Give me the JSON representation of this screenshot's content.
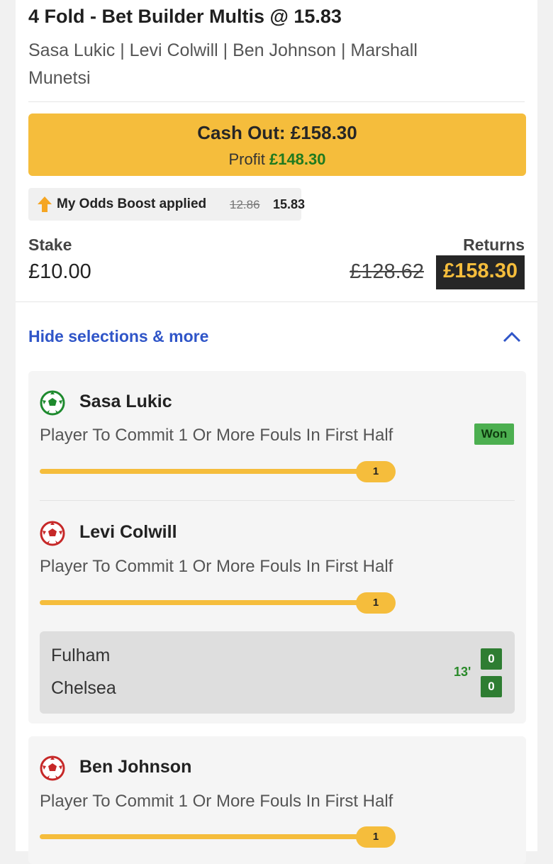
{
  "bet": {
    "title": "4 Fold - Bet Builder Multis @ 15.83",
    "players": "Sasa Lukic | Levi Colwill | Ben Johnson | Marshall Munetsi"
  },
  "cashout": {
    "label": "Cash Out: £158.30",
    "profit_label": "Profit",
    "profit_value": "£148.30"
  },
  "boost": {
    "label": "My Odds Boost applied",
    "old_odds": "12.86",
    "new_odds": "15.83",
    "icon": "arrow-up-icon"
  },
  "stake": {
    "label": "Stake",
    "value": "£10.00"
  },
  "returns": {
    "label": "Returns",
    "old_value": "£128.62",
    "value": "£158.30"
  },
  "toggle": {
    "label": "Hide selections & more",
    "icon": "chevron-up-icon"
  },
  "selections": [
    {
      "player": "Sasa Lukic",
      "market": "Player To Commit 1 Or More Fouls In First Half",
      "status": "Won",
      "progress": 1,
      "progress_fraction": 1.0,
      "icon": "football-icon",
      "icon_color": "#1e8a2e"
    },
    {
      "player": "Levi Colwill",
      "market": "Player To Commit 1 Or More Fouls In First Half",
      "progress": 1,
      "progress_fraction": 1.0,
      "icon": "football-icon",
      "icon_color": "#c62828"
    },
    {
      "player": "Ben Johnson",
      "market": "Player To Commit 1 Or More Fouls In First Half",
      "progress": 1,
      "progress_fraction": 1.0,
      "icon": "football-icon",
      "icon_color": "#c62828"
    }
  ],
  "match": {
    "home": "Fulham",
    "away": "Chelsea",
    "minute": "13'",
    "home_score": "0",
    "away_score": "0"
  },
  "colors": {
    "accent": "#f5bd3c",
    "link": "#2f55c8",
    "profit": "#1f7a1f",
    "won": "#4caf50",
    "score_bg": "#2e7d32"
  }
}
